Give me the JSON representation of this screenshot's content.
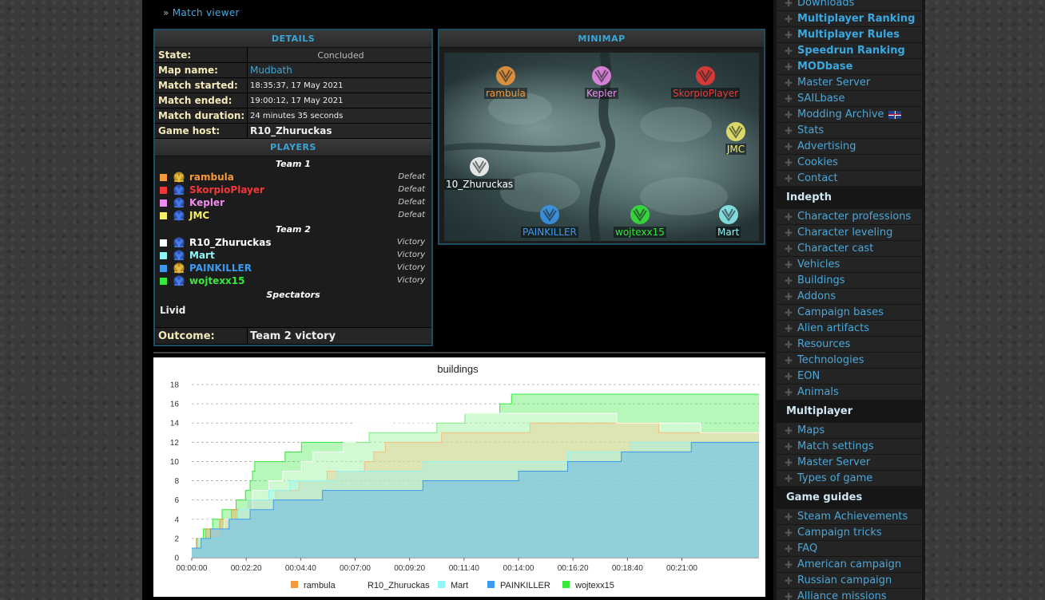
{
  "breadcrumb": {
    "prefix": "»",
    "link": "Match viewer"
  },
  "details": {
    "header": "DETAILS",
    "rows": [
      {
        "label": "State:",
        "value": "Concluded"
      },
      {
        "label": "Map name:",
        "value": "Mudbath"
      },
      {
        "label": "Match started:",
        "value": "18:35:37, 17 May 2021"
      },
      {
        "label": "Match ended:",
        "value": "19:00:12, 17 May 2021"
      },
      {
        "label": "Match duration:",
        "value": "24 minutes 35 seconds"
      },
      {
        "label": "Game host:",
        "value": "R10_Zhuruckas"
      }
    ],
    "players_header": "PLAYERS",
    "teams": [
      {
        "title": "Team 1",
        "players": [
          {
            "name": "rambula",
            "color": "#f49a3c",
            "result": "Defeat",
            "faction": "gold"
          },
          {
            "name": "SkorpioPlayer",
            "color": "#f2393a",
            "result": "Defeat",
            "faction": "blue"
          },
          {
            "name": "Kepler",
            "color": "#f08cf0",
            "result": "Defeat",
            "faction": "blue"
          },
          {
            "name": "JMC",
            "color": "#f5f06c",
            "result": "Defeat",
            "faction": "blue"
          }
        ]
      },
      {
        "title": "Team 2",
        "players": [
          {
            "name": "R10_Zhuruckas",
            "color": "#ffffff",
            "result": "Victory",
            "faction": "blue"
          },
          {
            "name": "Mart",
            "color": "#8ff5f5",
            "result": "Victory",
            "faction": "blue"
          },
          {
            "name": "PAINKILLER",
            "color": "#3b9af0",
            "result": "Victory",
            "faction": "gold"
          },
          {
            "name": "wojtexx15",
            "color": "#35e83a",
            "result": "Victory",
            "faction": "blue"
          }
        ]
      }
    ],
    "spectators_title": "Spectators",
    "spectators": [
      "Livid"
    ],
    "outcome_label": "Outcome:",
    "outcome_value": "Team 2 victory"
  },
  "minimap": {
    "header": "MINIMAP",
    "markers": [
      {
        "name": "rambula",
        "color": "#f49a3c",
        "faction": "gold"
      },
      {
        "name": "Kepler",
        "color": "#f08cf0",
        "faction": "blue"
      },
      {
        "name": "SkorpioPlayer",
        "color": "#f2393a",
        "faction": "blue"
      },
      {
        "name": "JMC",
        "color": "#f5f06c",
        "faction": "blue"
      },
      {
        "name": "10_Zhuruckas",
        "color": "#ffffff",
        "faction": "blue"
      },
      {
        "name": "PAINKILLER",
        "color": "#3b9af0",
        "faction": "gold"
      },
      {
        "name": "wojtexx15",
        "color": "#35e83a",
        "faction": "blue"
      },
      {
        "name": "Mart",
        "color": "#8ff5f5",
        "faction": "blue"
      }
    ]
  },
  "sidebar": {
    "top_items": [
      {
        "label": "Downloads",
        "hl": false
      },
      {
        "label": "Multiplayer Ranking",
        "hl": true
      },
      {
        "label": "Multiplayer Rules",
        "hl": true
      },
      {
        "label": "Speedrun Ranking",
        "hl": true
      },
      {
        "label": "MODbase",
        "hl": true
      },
      {
        "label": "Master Server",
        "hl": false
      },
      {
        "label": "SAILbase",
        "hl": false
      },
      {
        "label": "Modding Archive",
        "hl": false,
        "flag": true
      },
      {
        "label": "Stats",
        "hl": false
      },
      {
        "label": "Advertising",
        "hl": false
      },
      {
        "label": "Cookies",
        "hl": false
      },
      {
        "label": "Contact",
        "hl": false
      }
    ],
    "sections": [
      {
        "title": "Indepth",
        "items": [
          "Character professions",
          "Character leveling",
          "Character cast",
          "Vehicles",
          "Buildings",
          "Addons",
          "Campaign bases",
          "Alien artifacts",
          "Resources",
          "Technologies",
          "EON",
          "Animals"
        ]
      },
      {
        "title": "Multiplayer",
        "items": [
          "Maps",
          "Match settings",
          "Master Server",
          "Types of game"
        ]
      },
      {
        "title": "Game guides",
        "items": [
          "Steam Achievements",
          "Campaign tricks",
          "FAQ",
          "American campaign",
          "Russian campaign",
          "Alliance missions"
        ]
      }
    ]
  },
  "chart_data": {
    "type": "area",
    "title": "buildings",
    "xlabel": "",
    "ylabel": "",
    "x_ticks": [
      "00:00:00",
      "00:02:20",
      "00:04:40",
      "00:07:00",
      "00:09:20",
      "00:11:40",
      "00:14:00",
      "00:16:20",
      "00:18:40",
      "00:21:00"
    ],
    "ylim": [
      0,
      18
    ],
    "y_ticks": [
      0,
      2,
      4,
      6,
      8,
      10,
      12,
      14,
      16,
      18
    ],
    "grid": true,
    "legend_position": "bottom",
    "x_unit": "minutes",
    "series": [
      {
        "name": "rambula",
        "color": "#f49a3c",
        "points": [
          [
            0,
            1
          ],
          [
            0.2,
            2
          ],
          [
            0.6,
            3
          ],
          [
            1.2,
            4
          ],
          [
            1.7,
            5
          ],
          [
            2.4,
            6
          ],
          [
            3.6,
            7
          ],
          [
            4.6,
            8
          ],
          [
            5.8,
            9
          ],
          [
            7.4,
            10
          ],
          [
            7.8,
            11
          ],
          [
            8.3,
            12
          ],
          [
            10.7,
            13
          ],
          [
            14.5,
            14
          ],
          [
            20,
            13
          ],
          [
            24.3,
            13
          ]
        ]
      },
      {
        "name": "R10_Zhuruckas",
        "color": "#ffffff",
        "points": [
          [
            0,
            1
          ],
          [
            0.3,
            2
          ],
          [
            0.8,
            3
          ],
          [
            1.4,
            4
          ],
          [
            2.0,
            5
          ],
          [
            2.6,
            7
          ],
          [
            3.3,
            8
          ],
          [
            3.9,
            9
          ],
          [
            4.7,
            10
          ],
          [
            5.2,
            11
          ],
          [
            6.5,
            12
          ],
          [
            7.0,
            14
          ],
          [
            8.5,
            15
          ],
          [
            10.2,
            15
          ],
          [
            18.2,
            14
          ],
          [
            21.8,
            13
          ],
          [
            24.3,
            13
          ]
        ]
      },
      {
        "name": "Mart",
        "color": "#8ff5f5",
        "points": [
          [
            0,
            1
          ],
          [
            0.3,
            2
          ],
          [
            1.3,
            3
          ],
          [
            1.7,
            4
          ],
          [
            2.0,
            5
          ],
          [
            2.4,
            6
          ],
          [
            3.3,
            7
          ],
          [
            4.2,
            8
          ],
          [
            6.2,
            9
          ],
          [
            9.9,
            10
          ],
          [
            16.1,
            11
          ],
          [
            18.8,
            12
          ],
          [
            24.3,
            12
          ]
        ]
      },
      {
        "name": "PAINKILLER",
        "color": "#3b9af0",
        "points": [
          [
            0,
            1
          ],
          [
            0.4,
            2
          ],
          [
            0.8,
            3
          ],
          [
            1.6,
            4
          ],
          [
            2.5,
            5
          ],
          [
            3.5,
            6
          ],
          [
            5.6,
            7
          ],
          [
            9.9,
            8
          ],
          [
            14.0,
            9
          ],
          [
            16.1,
            10
          ],
          [
            18.4,
            11
          ],
          [
            21.4,
            12
          ],
          [
            24.3,
            12
          ]
        ]
      },
      {
        "name": "wojtexx15",
        "color": "#35e83a",
        "points": [
          [
            0,
            1
          ],
          [
            0.2,
            2
          ],
          [
            0.5,
            3
          ],
          [
            0.9,
            4
          ],
          [
            1.3,
            5
          ],
          [
            1.9,
            6
          ],
          [
            2.3,
            7
          ],
          [
            2.5,
            8
          ],
          [
            2.6,
            9
          ],
          [
            2.7,
            10
          ],
          [
            4.0,
            11
          ],
          [
            4.7,
            12
          ],
          [
            7.6,
            13
          ],
          [
            10.5,
            14
          ],
          [
            11.7,
            15
          ],
          [
            13.2,
            16
          ],
          [
            13.7,
            17
          ],
          [
            24.3,
            17
          ]
        ]
      }
    ]
  }
}
